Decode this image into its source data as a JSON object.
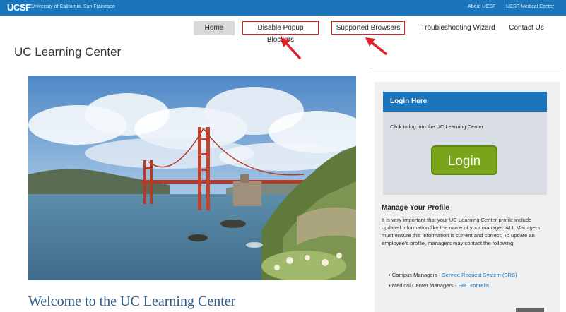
{
  "topbar": {
    "logo": "UCSF",
    "university": "University of California, San Francisco",
    "about_link": "About UCSF",
    "medical_link": "UCSF Medical Center"
  },
  "nav": {
    "home": "Home",
    "popup": "Disable Popup Blockers",
    "browsers": "Supported Browsers",
    "troubleshooting": "Troubleshooting Wizard",
    "contact": "Contact Us"
  },
  "page_title": "UC Learning Center",
  "login": {
    "header": "Login Here",
    "text": "Click to log into the UC Learning Center",
    "button": "Login"
  },
  "manage": {
    "heading": "Manage Your Profile",
    "paragraph": "It is very important that your UC Learning Center profile include updated information like the name of your manager. ALL Managers must ensure this information is current and correct. To update an employee's profile, managers may contact the following:",
    "bullets": [
      {
        "prefix": "Campus Managers - ",
        "link": "Service Request System (SRS)"
      },
      {
        "prefix": "Medical Center Managers - ",
        "link": "HR Umbrella"
      }
    ]
  },
  "welcome": "Welcome to the UC Learning Center",
  "colors": {
    "brand_blue": "#1a75bb",
    "login_green": "#7aa51a",
    "highlight_red": "#e0202a"
  },
  "icons": [
    "red-arrow-icon"
  ]
}
